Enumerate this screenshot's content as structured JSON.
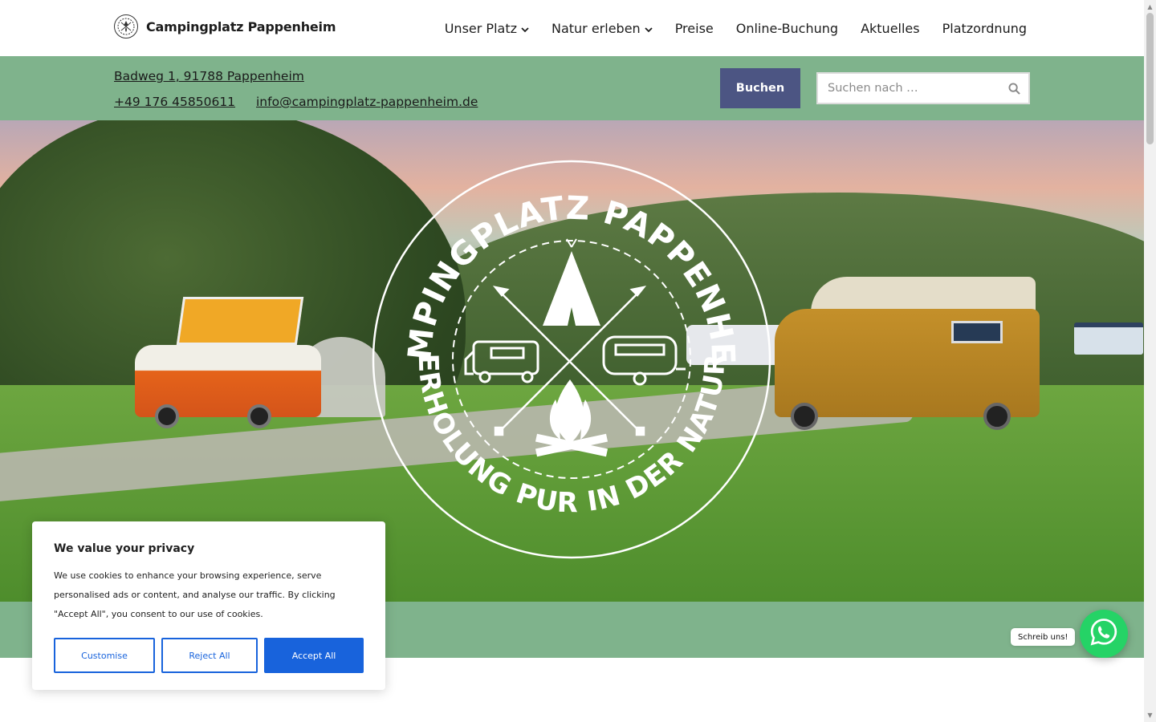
{
  "brand": {
    "name": "Campingplatz Pappenheim",
    "logo_icon": "campsite-logo-icon"
  },
  "nav": {
    "items": [
      {
        "label": "Unser Platz",
        "has_dropdown": true
      },
      {
        "label": "Natur erleben",
        "has_dropdown": true
      },
      {
        "label": "Preise",
        "has_dropdown": false
      },
      {
        "label": "Online-Buchung",
        "has_dropdown": false
      },
      {
        "label": "Aktuelles",
        "has_dropdown": false
      },
      {
        "label": "Platzordnung",
        "has_dropdown": false
      }
    ],
    "dropdown_icon": "chevron-down-icon"
  },
  "infobar": {
    "address": "Badweg 1, 91788 Pappenheim",
    "phone": "+49 176 45850611",
    "email": "info@campingplatz-pappenheim.de",
    "book_label": "Buchen",
    "search_placeholder": "Suchen nach …",
    "search_icon": "search-icon",
    "background_color": "#7fb38c",
    "button_color": "#4c5583"
  },
  "hero": {
    "badge_top_text": "CAMPINGPLATZ PAPPENHEIM",
    "badge_bottom_text": "ERHOLUNG PUR IN DER NATUR",
    "badge_icons": [
      "teepee-icon",
      "motorhome-icon",
      "caravan-icon",
      "campfire-icon",
      "crossed-arrows-icon"
    ]
  },
  "cookie": {
    "title": "We value your privacy",
    "text": "We use cookies to enhance your browsing experience, serve personalised ads or content, and analyse our traffic. By clicking \"Accept All\", you consent to our use of cookies.",
    "customise_label": "Customise",
    "reject_label": "Reject All",
    "accept_label": "Accept All",
    "accent_color": "#1863dc"
  },
  "whatsapp": {
    "label": "Schreib uns!",
    "icon": "whatsapp-icon",
    "color": "#25d366"
  }
}
